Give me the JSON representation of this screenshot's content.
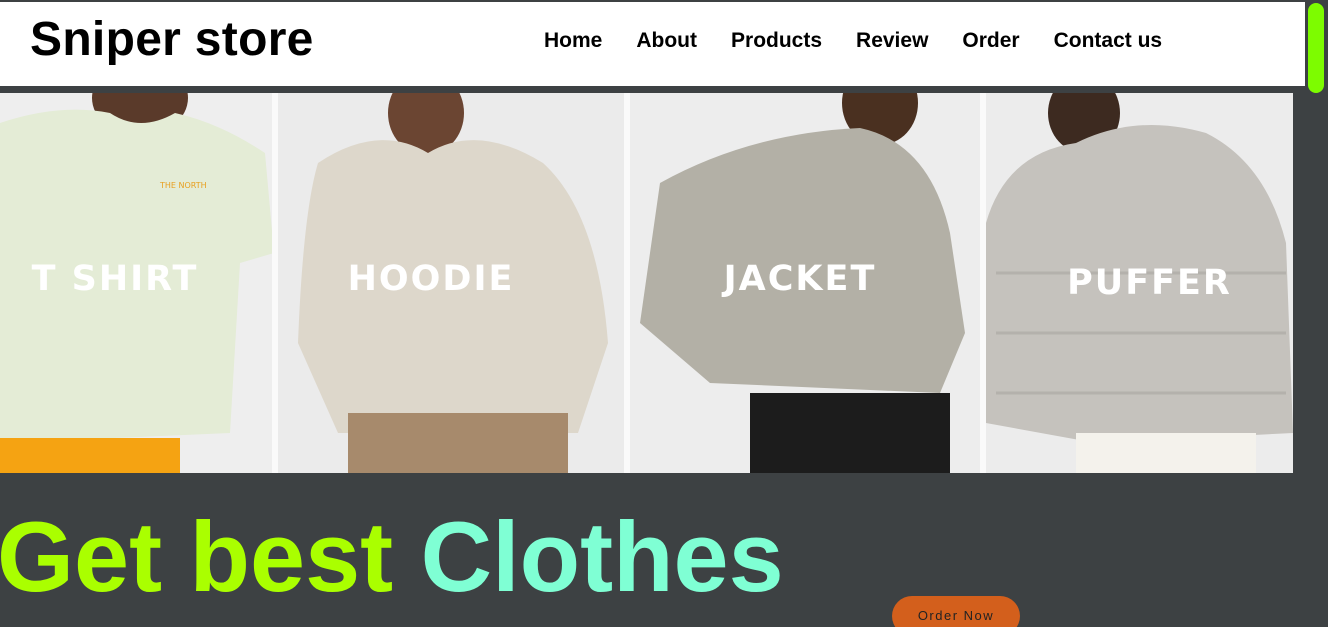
{
  "header": {
    "logo": "Sniper store",
    "nav": [
      "Home",
      "About",
      "Products",
      "Review",
      "Order",
      "Contact us"
    ]
  },
  "banner": {
    "panels": [
      {
        "label": "T SHIRT"
      },
      {
        "label": "HOODIE"
      },
      {
        "label": "JACKET"
      },
      {
        "label": "PUFFER"
      }
    ]
  },
  "hero": {
    "word1": "Get best",
    "word2": "Clothes",
    "order_label": "Order Now"
  },
  "colors": {
    "accent_green": "#aaff00",
    "aquamarine": "#7fffd4",
    "button_orange": "#d35f1c",
    "scroll_thumb": "#7dfc00",
    "background": "#3d4143"
  }
}
